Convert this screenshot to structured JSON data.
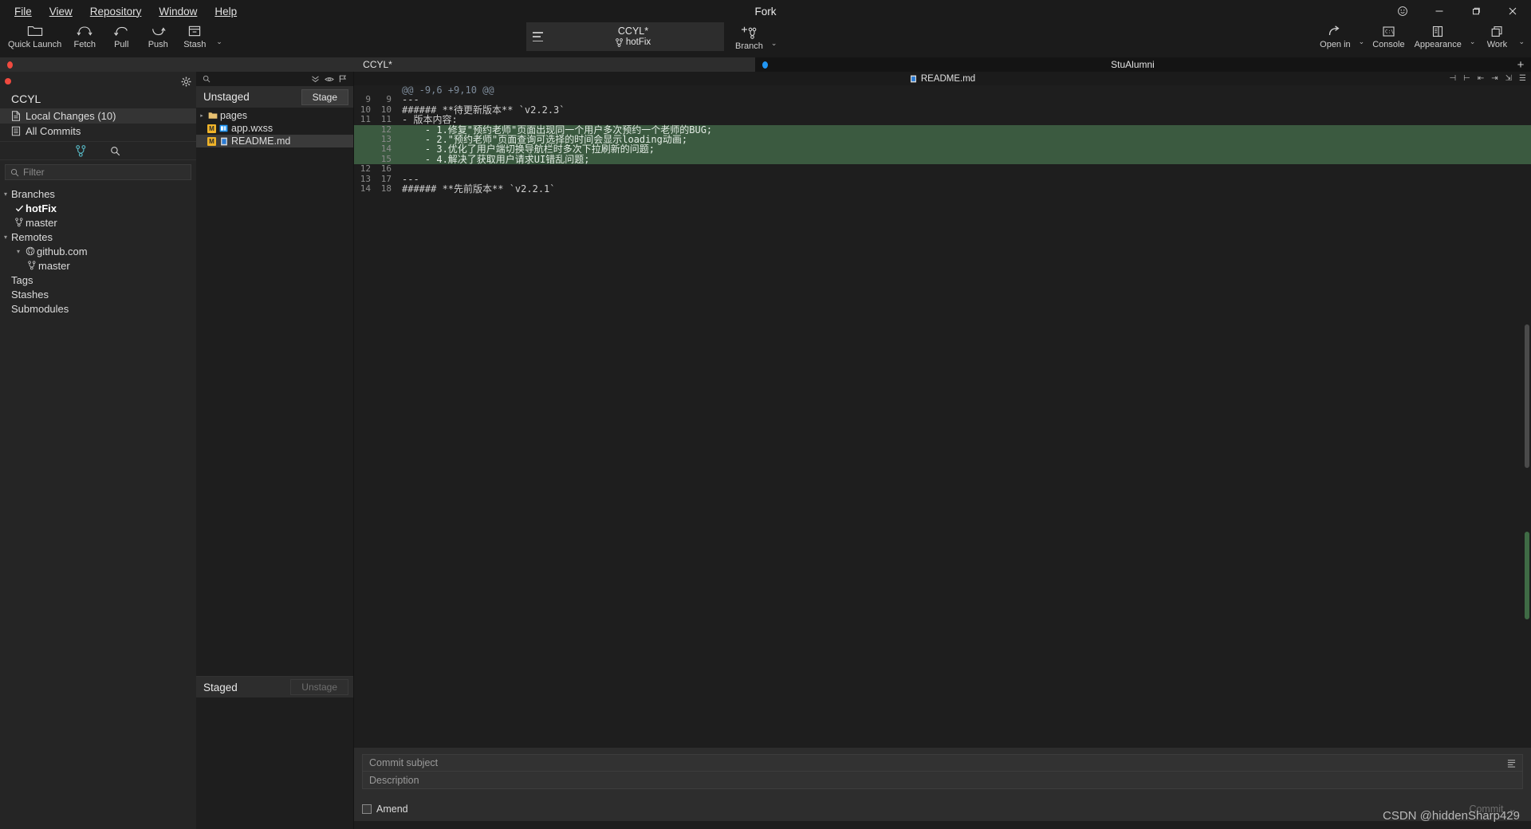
{
  "window": {
    "app_title": "Fork",
    "controls": {
      "emoji": "smiley-icon",
      "minimize": "–",
      "maximize": "❐",
      "close": "✕"
    }
  },
  "menubar": {
    "items": [
      {
        "label": "File",
        "accel": "F"
      },
      {
        "label": "View",
        "accel": "V"
      },
      {
        "label": "Repository",
        "accel": "R"
      },
      {
        "label": "Window",
        "accel": "W"
      },
      {
        "label": "Help",
        "accel": "H"
      }
    ]
  },
  "toolbar": {
    "left": [
      {
        "label": "Quick Launch",
        "icon": "folder-icon"
      },
      {
        "label": "Fetch",
        "icon": "fetch-icon"
      },
      {
        "label": "Pull",
        "icon": "pull-icon"
      },
      {
        "label": "Push",
        "icon": "push-icon"
      },
      {
        "label": "Stash",
        "icon": "stash-icon"
      }
    ],
    "stash_caret": "⌄",
    "repo_selector": {
      "name": "CCYL*",
      "branch": "hotFix",
      "branch_icon": "branch-icon",
      "menu_icon": "hamburger-icon"
    },
    "branch_button": {
      "label": "Branch",
      "icon": "new-branch-icon",
      "caret": "⌄"
    },
    "right": [
      {
        "label": "Open in",
        "icon": "open-in-icon",
        "caret": "⌄"
      },
      {
        "label": "Console",
        "icon": "console-icon",
        "caret": ""
      },
      {
        "label": "Appearance",
        "icon": "appearance-icon",
        "caret": "⌄"
      },
      {
        "label": "Work",
        "icon": "workspace-icon",
        "caret": "⌄"
      }
    ]
  },
  "tabs": {
    "items": [
      {
        "label": "CCYL*",
        "dot": "red",
        "active": true
      },
      {
        "label": "StuAlumni",
        "dot": "blue",
        "active": false
      }
    ],
    "add_label": "+"
  },
  "sidebar": {
    "repo_title": "CCYL",
    "gear_icon": "gear-icon",
    "nav": [
      {
        "label": "Local Changes (10)",
        "icon": "changes-icon",
        "selected": true
      },
      {
        "label": "All Commits",
        "icon": "commits-icon",
        "selected": false
      }
    ],
    "tools": [
      {
        "icon": "branch-icon"
      },
      {
        "icon": "search-icon"
      }
    ],
    "filter_placeholder": "Filter",
    "filter_value": "",
    "tree": [
      {
        "label": "Branches",
        "level": 1,
        "twisty": "▾",
        "icon": "",
        "current": false
      },
      {
        "label": "hotFix",
        "level": 2,
        "twisty": "",
        "icon": "check-icon",
        "current": true
      },
      {
        "label": "master",
        "level": 2,
        "twisty": "",
        "icon": "branch-icon",
        "current": false
      },
      {
        "label": "Remotes",
        "level": 1,
        "twisty": "▾",
        "icon": "",
        "current": false
      },
      {
        "label": "github.com",
        "level": 2,
        "twisty": "▾",
        "icon": "github-icon",
        "current": false
      },
      {
        "label": "master",
        "level": 3,
        "twisty": "",
        "icon": "branch-icon",
        "current": false
      },
      {
        "label": "Tags",
        "level": 1,
        "twisty": "",
        "icon": "",
        "current": false
      },
      {
        "label": "Stashes",
        "level": 1,
        "twisty": "",
        "icon": "",
        "current": false
      },
      {
        "label": "Submodules",
        "level": 1,
        "twisty": "",
        "icon": "",
        "current": false
      }
    ]
  },
  "changes": {
    "search_placeholder": "",
    "search_icons": [
      "search-icon",
      "collapse-icon",
      "eye-icon",
      "flag-icon"
    ],
    "unstaged": {
      "title": "Unstaged",
      "action_label": "Stage",
      "files": [
        {
          "name": "pages",
          "type": "folder",
          "status": "",
          "arrow": "▸",
          "selected": false
        },
        {
          "name": "app.wxss",
          "type": "file",
          "status": "M",
          "arrow": "",
          "selected": false
        },
        {
          "name": "README.md",
          "type": "file",
          "status": "M",
          "arrow": "",
          "selected": true
        }
      ]
    },
    "staged": {
      "title": "Staged",
      "action_label": "Unstage",
      "action_disabled": true,
      "files": []
    }
  },
  "diff": {
    "file_name": "README.md",
    "file_icon": "markdown-icon",
    "header_icons": [
      "split-left-icon",
      "split-right-icon",
      "collapse-icon",
      "expand-icon",
      "wrap-icon",
      "list-icon"
    ],
    "lines": [
      {
        "old": "",
        "new": "",
        "text": "@@ -9,6 +9,10 @@",
        "kind": "meta"
      },
      {
        "old": "9",
        "new": "9",
        "text": "---",
        "kind": "context"
      },
      {
        "old": "10",
        "new": "10",
        "text": "###### **待更新版本** `v2.2.3`",
        "kind": "context"
      },
      {
        "old": "11",
        "new": "11",
        "text": "- 版本内容:",
        "kind": "context"
      },
      {
        "old": "",
        "new": "12",
        "text": "    - 1.修复\"预约老师\"页面出现同一个用户多次预约一个老师的BUG;",
        "kind": "add"
      },
      {
        "old": "",
        "new": "13",
        "text": "    - 2.\"预约老师\"页面查询可选择的时间会显示loading动画;",
        "kind": "add"
      },
      {
        "old": "",
        "new": "14",
        "text": "    - 3.优化了用户端切换导航栏时多次下拉刷新的问题;",
        "kind": "add"
      },
      {
        "old": "",
        "new": "15",
        "text": "    - 4.解决了获取用户请求UI错乱问题;",
        "kind": "add"
      },
      {
        "old": "12",
        "new": "16",
        "text": "",
        "kind": "context"
      },
      {
        "old": "13",
        "new": "17",
        "text": "---",
        "kind": "context"
      },
      {
        "old": "14",
        "new": "18",
        "text": "###### **先前版本** `v2.2.1`",
        "kind": "context"
      }
    ]
  },
  "commit": {
    "subject_placeholder": "Commit subject",
    "subject_value": "",
    "description_placeholder": "Description",
    "description_value": "",
    "amend_label": "Amend",
    "amend_checked": false,
    "commit_label": "Commit",
    "commit_caret": "⌄",
    "commit_disabled": true,
    "menu_icon": "list-icon"
  },
  "watermark": "CSDN @hiddenSharp429",
  "colors": {
    "accent_blue": "#2196f3",
    "dot_red": "#f04a3f",
    "add_green": "#3b5a40",
    "modified_yellow": "#f0b429",
    "folder_yellow": "#e8c070"
  }
}
